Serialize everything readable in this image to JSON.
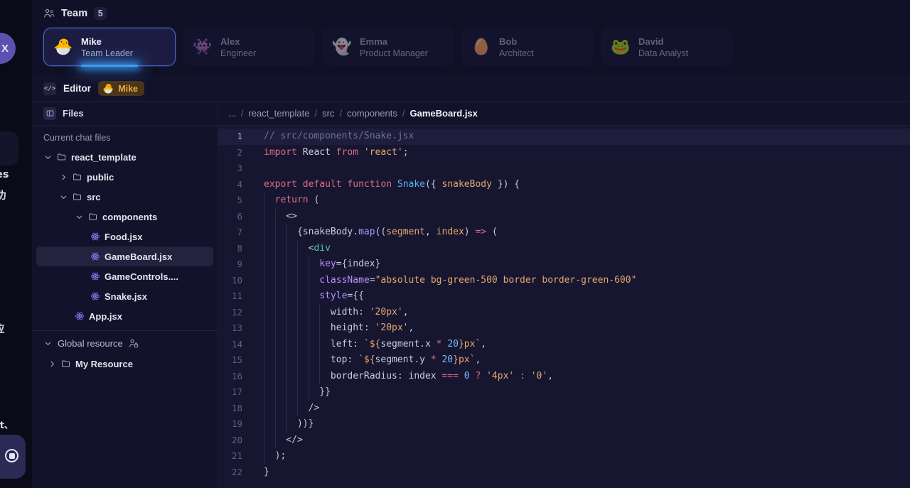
{
  "left_strip": {
    "close_label": "X",
    "snippets": [
      "es",
      "功",
      "应",
      "ct、"
    ],
    "record_icon": "record-icon"
  },
  "team": {
    "icon": "people-icon",
    "label": "Team",
    "count": "5",
    "members": [
      {
        "name": "Mike",
        "role": "Team Leader",
        "avatar": "🐣",
        "selected": true
      },
      {
        "name": "Alex",
        "role": "Engineer",
        "avatar": "👾",
        "selected": false
      },
      {
        "name": "Emma",
        "role": "Product Manager",
        "avatar": "👻",
        "selected": false
      },
      {
        "name": "Bob",
        "role": "Architect",
        "avatar": "🥚",
        "selected": false
      },
      {
        "name": "David",
        "role": "Data Analyst",
        "avatar": "🐸",
        "selected": false
      }
    ]
  },
  "editor_bar": {
    "icon": "code-icon",
    "title": "Editor",
    "owner_avatar": "🐣",
    "owner_name": "Mike"
  },
  "files_panel": {
    "icon": "panel-icon",
    "header": "Files",
    "section_title": "Current chat files",
    "tree": [
      {
        "label": "react_template",
        "type": "folder",
        "depth": 0,
        "expanded": true,
        "active": false
      },
      {
        "label": "public",
        "type": "folder",
        "depth": 1,
        "expanded": false,
        "active": false
      },
      {
        "label": "src",
        "type": "folder",
        "depth": 1,
        "expanded": true,
        "active": false
      },
      {
        "label": "components",
        "type": "folder",
        "depth": 2,
        "expanded": true,
        "active": false
      },
      {
        "label": "Food.jsx",
        "type": "react",
        "depth": 3,
        "active": false
      },
      {
        "label": "GameBoard.jsx",
        "type": "react",
        "depth": 3,
        "active": true
      },
      {
        "label": "GameControls....",
        "type": "react",
        "depth": 3,
        "active": false
      },
      {
        "label": "Snake.jsx",
        "type": "react",
        "depth": 3,
        "active": false
      },
      {
        "label": "App.jsx",
        "type": "react",
        "depth": 2,
        "active": false
      }
    ],
    "global_resource": {
      "label": "Global resource",
      "icon": "person-lock-icon",
      "expanded": true
    },
    "my_resource": {
      "label": "My Resource",
      "type": "folder",
      "expanded": false
    }
  },
  "breadcrumb": {
    "items": [
      "...",
      "react_template",
      "src",
      "components",
      "GameBoard.jsx"
    ],
    "separator": "/"
  },
  "code": {
    "language": "jsx",
    "active_line": 1,
    "lines": [
      {
        "n": 1,
        "guides": [],
        "tokens": [
          {
            "t": "// src/components/Snake.jsx",
            "c": "t-com"
          }
        ]
      },
      {
        "n": 2,
        "guides": [],
        "tokens": [
          {
            "t": "import",
            "c": "t-kw"
          },
          {
            "t": " ",
            "c": "t-pun"
          },
          {
            "t": "React",
            "c": "t-var"
          },
          {
            "t": " ",
            "c": "t-pun"
          },
          {
            "t": "from",
            "c": "t-kw"
          },
          {
            "t": " ",
            "c": "t-pun"
          },
          {
            "t": "'react'",
            "c": "t-str"
          },
          {
            "t": ";",
            "c": "t-pun"
          }
        ]
      },
      {
        "n": 3,
        "guides": [],
        "tokens": [
          {
            "t": "",
            "c": "t-pun"
          }
        ]
      },
      {
        "n": 4,
        "guides": [],
        "tokens": [
          {
            "t": "export",
            "c": "t-kw"
          },
          {
            "t": " ",
            "c": "t-pun"
          },
          {
            "t": "default",
            "c": "t-kw"
          },
          {
            "t": " ",
            "c": "t-pun"
          },
          {
            "t": "function",
            "c": "t-kw"
          },
          {
            "t": " ",
            "c": "t-pun"
          },
          {
            "t": "Snake",
            "c": "t-fn"
          },
          {
            "t": "({ ",
            "c": "t-pun"
          },
          {
            "t": "snakeBody",
            "c": "t-str"
          },
          {
            "t": " }) {",
            "c": "t-pun"
          }
        ]
      },
      {
        "n": 5,
        "guides": [
          0
        ],
        "tokens": [
          {
            "t": "  ",
            "c": "t-pun"
          },
          {
            "t": "return",
            "c": "t-kw"
          },
          {
            "t": " (",
            "c": "t-pun"
          }
        ]
      },
      {
        "n": 6,
        "guides": [
          0,
          1
        ],
        "tokens": [
          {
            "t": "    <>",
            "c": "t-pun"
          }
        ]
      },
      {
        "n": 7,
        "guides": [
          0,
          1,
          2
        ],
        "tokens": [
          {
            "t": "      {",
            "c": "t-pun"
          },
          {
            "t": "snakeBody",
            "c": "t-var"
          },
          {
            "t": ".",
            "c": "t-pun"
          },
          {
            "t": "map",
            "c": "t-prop"
          },
          {
            "t": "((",
            "c": "t-pun"
          },
          {
            "t": "segment",
            "c": "t-str"
          },
          {
            "t": ", ",
            "c": "t-pun"
          },
          {
            "t": "index",
            "c": "t-str"
          },
          {
            "t": ") ",
            "c": "t-pun"
          },
          {
            "t": "=>",
            "c": "t-op"
          },
          {
            "t": " (",
            "c": "t-pun"
          }
        ]
      },
      {
        "n": 8,
        "guides": [
          0,
          1,
          2,
          3
        ],
        "tokens": [
          {
            "t": "        <",
            "c": "t-pun"
          },
          {
            "t": "div",
            "c": "t-tag"
          }
        ]
      },
      {
        "n": 9,
        "guides": [
          0,
          1,
          2,
          3,
          4
        ],
        "tokens": [
          {
            "t": "          ",
            "c": "t-pun"
          },
          {
            "t": "key",
            "c": "t-atr"
          },
          {
            "t": "={",
            "c": "t-pun"
          },
          {
            "t": "index",
            "c": "t-var"
          },
          {
            "t": "}",
            "c": "t-pun"
          }
        ]
      },
      {
        "n": 10,
        "guides": [
          0,
          1,
          2,
          3,
          4
        ],
        "tokens": [
          {
            "t": "          ",
            "c": "t-pun"
          },
          {
            "t": "className",
            "c": "t-atr"
          },
          {
            "t": "=",
            "c": "t-pun"
          },
          {
            "t": "\"absolute bg-green-500 border border-green-600\"",
            "c": "t-str"
          }
        ]
      },
      {
        "n": 11,
        "guides": [
          0,
          1,
          2,
          3,
          4
        ],
        "tokens": [
          {
            "t": "          ",
            "c": "t-pun"
          },
          {
            "t": "style",
            "c": "t-atr"
          },
          {
            "t": "={{",
            "c": "t-pun"
          }
        ]
      },
      {
        "n": 12,
        "guides": [
          0,
          1,
          2,
          3,
          4,
          5
        ],
        "tokens": [
          {
            "t": "            ",
            "c": "t-pun"
          },
          {
            "t": "width",
            "c": "t-var"
          },
          {
            "t": ": ",
            "c": "t-pun"
          },
          {
            "t": "'20px'",
            "c": "t-str"
          },
          {
            "t": ",",
            "c": "t-pun"
          }
        ]
      },
      {
        "n": 13,
        "guides": [
          0,
          1,
          2,
          3,
          4,
          5
        ],
        "tokens": [
          {
            "t": "            ",
            "c": "t-pun"
          },
          {
            "t": "height",
            "c": "t-var"
          },
          {
            "t": ": ",
            "c": "t-pun"
          },
          {
            "t": "'20px'",
            "c": "t-str"
          },
          {
            "t": ",",
            "c": "t-pun"
          }
        ]
      },
      {
        "n": 14,
        "guides": [
          0,
          1,
          2,
          3,
          4,
          5
        ],
        "tokens": [
          {
            "t": "            ",
            "c": "t-pun"
          },
          {
            "t": "left",
            "c": "t-var"
          },
          {
            "t": ": ",
            "c": "t-pun"
          },
          {
            "t": "`${",
            "c": "t-str"
          },
          {
            "t": "segment",
            "c": "t-var"
          },
          {
            "t": ".",
            "c": "t-pun"
          },
          {
            "t": "x ",
            "c": "t-var"
          },
          {
            "t": "*",
            "c": "t-op"
          },
          {
            "t": " ",
            "c": "t-pun"
          },
          {
            "t": "20",
            "c": "t-num"
          },
          {
            "t": "}px`",
            "c": "t-str"
          },
          {
            "t": ",",
            "c": "t-pun"
          }
        ]
      },
      {
        "n": 15,
        "guides": [
          0,
          1,
          2,
          3,
          4,
          5
        ],
        "tokens": [
          {
            "t": "            ",
            "c": "t-pun"
          },
          {
            "t": "top",
            "c": "t-var"
          },
          {
            "t": ": ",
            "c": "t-pun"
          },
          {
            "t": "`${",
            "c": "t-str"
          },
          {
            "t": "segment",
            "c": "t-var"
          },
          {
            "t": ".",
            "c": "t-pun"
          },
          {
            "t": "y ",
            "c": "t-var"
          },
          {
            "t": "*",
            "c": "t-op"
          },
          {
            "t": " ",
            "c": "t-pun"
          },
          {
            "t": "20",
            "c": "t-num"
          },
          {
            "t": "}px`",
            "c": "t-str"
          },
          {
            "t": ",",
            "c": "t-pun"
          }
        ]
      },
      {
        "n": 16,
        "guides": [
          0,
          1,
          2,
          3,
          4,
          5
        ],
        "tokens": [
          {
            "t": "            ",
            "c": "t-pun"
          },
          {
            "t": "borderRadius",
            "c": "t-var"
          },
          {
            "t": ": ",
            "c": "t-pun"
          },
          {
            "t": "index",
            "c": "t-var"
          },
          {
            "t": " ",
            "c": "t-pun"
          },
          {
            "t": "===",
            "c": "t-op"
          },
          {
            "t": " ",
            "c": "t-pun"
          },
          {
            "t": "0",
            "c": "t-num"
          },
          {
            "t": " ",
            "c": "t-pun"
          },
          {
            "t": "?",
            "c": "t-op"
          },
          {
            "t": " ",
            "c": "t-pun"
          },
          {
            "t": "'4px'",
            "c": "t-str"
          },
          {
            "t": " ",
            "c": "t-pun"
          },
          {
            "t": ":",
            "c": "t-op"
          },
          {
            "t": " ",
            "c": "t-pun"
          },
          {
            "t": "'0'",
            "c": "t-str"
          },
          {
            "t": ",",
            "c": "t-pun"
          }
        ]
      },
      {
        "n": 17,
        "guides": [
          0,
          1,
          2,
          3,
          4
        ],
        "tokens": [
          {
            "t": "          }}",
            "c": "t-pun"
          }
        ]
      },
      {
        "n": 18,
        "guides": [
          0,
          1,
          2,
          3
        ],
        "tokens": [
          {
            "t": "        />",
            "c": "t-pun"
          }
        ]
      },
      {
        "n": 19,
        "guides": [
          0,
          1,
          2
        ],
        "tokens": [
          {
            "t": "      ))}",
            "c": "t-pun"
          }
        ]
      },
      {
        "n": 20,
        "guides": [
          0,
          1
        ],
        "tokens": [
          {
            "t": "    </>",
            "c": "t-pun"
          }
        ]
      },
      {
        "n": 21,
        "guides": [
          0
        ],
        "tokens": [
          {
            "t": "  );",
            "c": "t-pun"
          }
        ]
      },
      {
        "n": 22,
        "guides": [],
        "tokens": [
          {
            "t": "}",
            "c": "t-pun"
          }
        ]
      }
    ]
  },
  "colors": {
    "app_bg": "#12122b",
    "panel_bg": "#101027",
    "code_bg": "#161630",
    "accent_blue": "#3b9cf5",
    "accent_purple": "#5b52b0",
    "owner_chip_bg": "#4a3519",
    "owner_chip_text": "#f0a93c"
  }
}
